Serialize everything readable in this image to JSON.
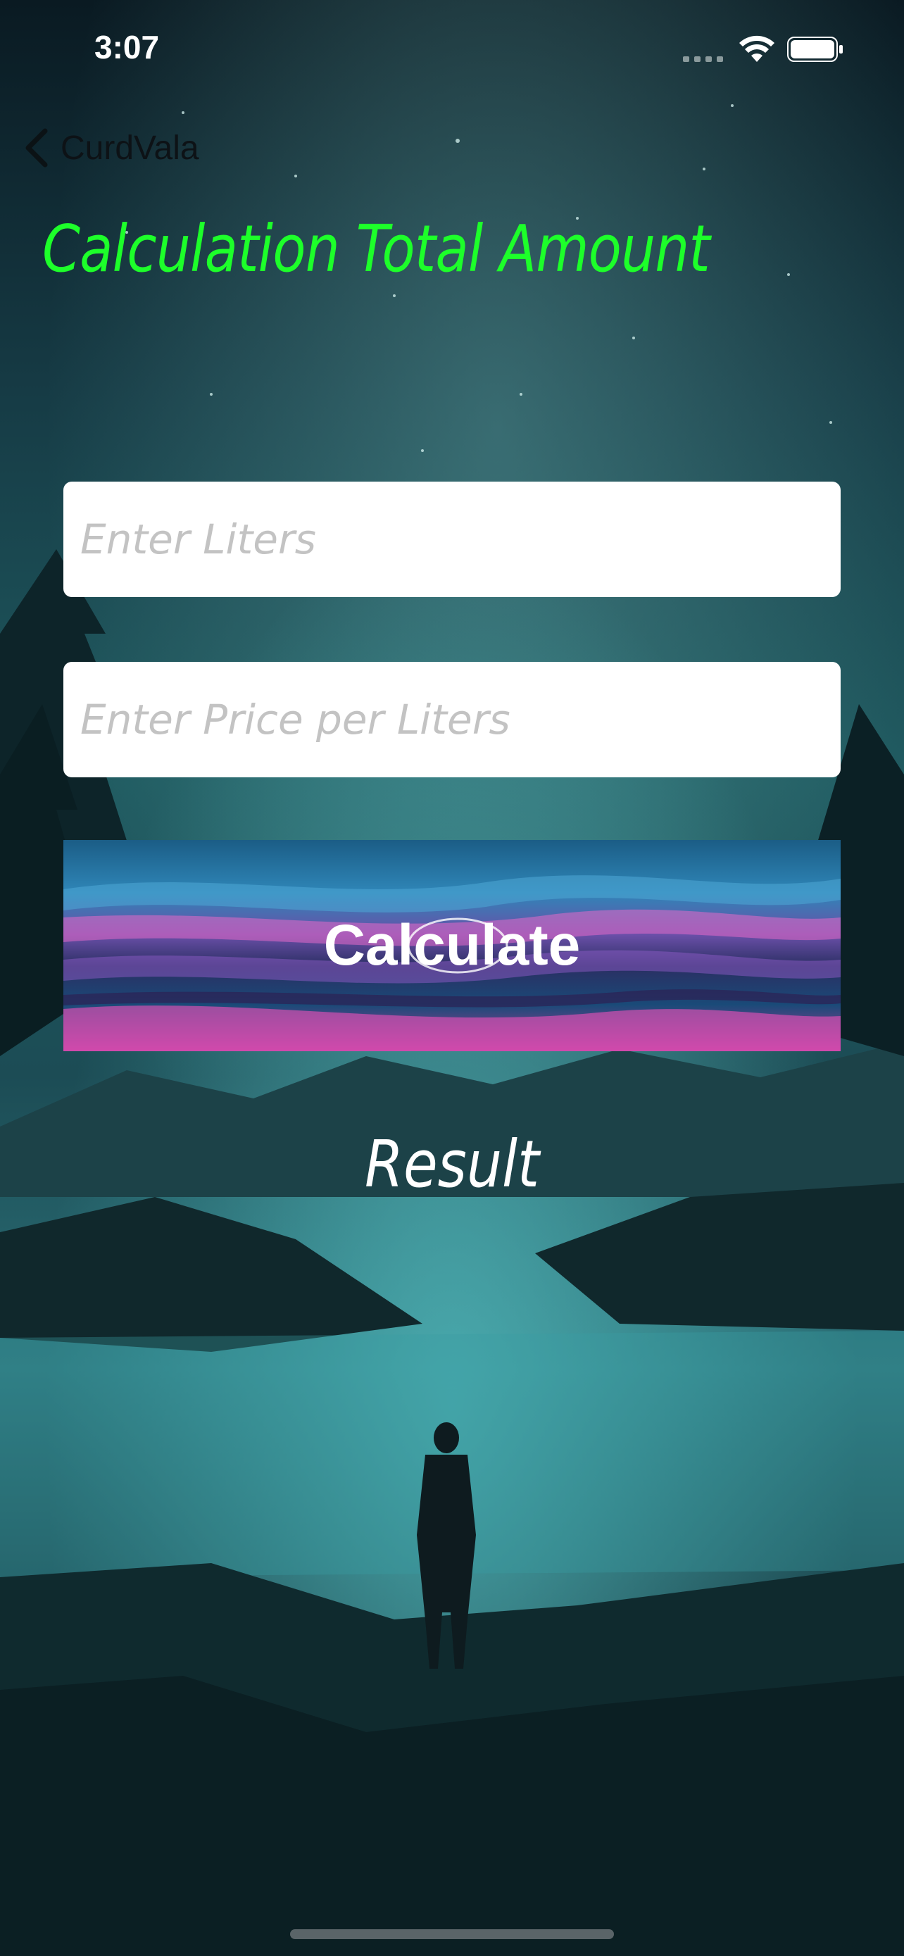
{
  "status_bar": {
    "time": "3:07"
  },
  "nav": {
    "back_label": "CurdVala"
  },
  "page": {
    "title": "Calculation Total Amount"
  },
  "form": {
    "liters_placeholder": "Enter Liters",
    "price_placeholder": "Enter Price per Liters",
    "calculate_label": "Calculate",
    "result_label": "Result"
  },
  "colors": {
    "title": "#1dff2a",
    "field_bg": "#ffffff",
    "placeholder": "#c3c3c3"
  }
}
